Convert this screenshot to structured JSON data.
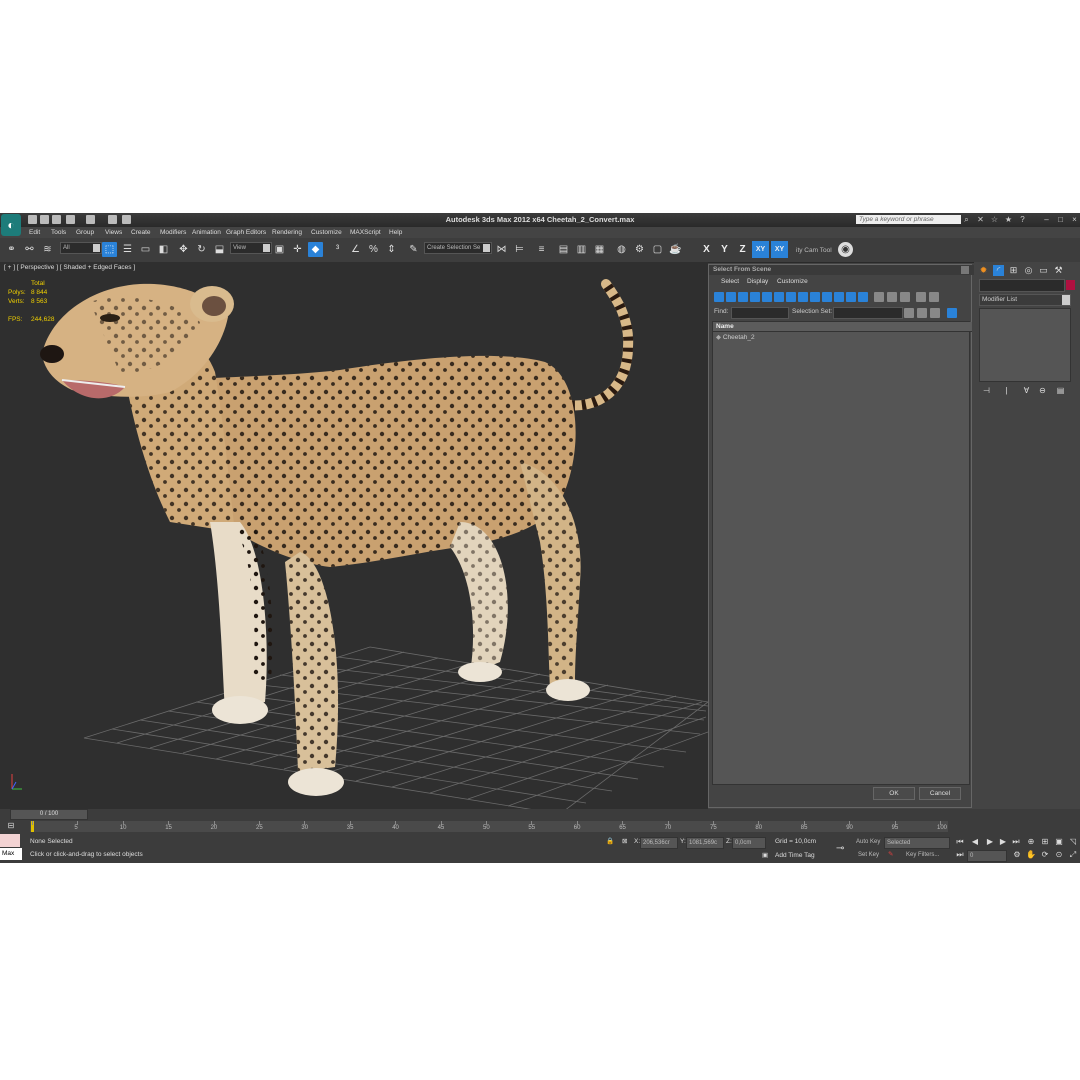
{
  "window": {
    "title": "Autodesk 3ds Max  2012 x64     Cheetah_2_Convert.max",
    "search_placeholder": "Type a keyword or phrase"
  },
  "menu": [
    "Edit",
    "Tools",
    "Group",
    "Views",
    "Create",
    "Modifiers",
    "Animation",
    "Graph Editors",
    "Rendering",
    "Customize",
    "MAXScript",
    "Help"
  ],
  "toolbar": {
    "filter_value": "All",
    "refcoord_value": "View",
    "named_selection": "Create Selection Se",
    "axis_buttons": [
      "X",
      "Y",
      "Z",
      "XY",
      "XY"
    ],
    "camtool_label": "ity Cam Tool"
  },
  "viewport": {
    "label": "[ + ] [ Perspective ] [ Shaded + Edged Faces ]",
    "stats": {
      "total_label": "Total",
      "polys_label": "Polys:",
      "polys_value": "8 844",
      "verts_label": "Verts:",
      "verts_value": "8 563",
      "fps_label": "FPS:",
      "fps_value": "244,628"
    }
  },
  "dialog": {
    "title": "Select From Scene",
    "menu": [
      "Select",
      "Display",
      "Customize"
    ],
    "find_label": "Find:",
    "selection_set_label": "Selection Set:",
    "list_header": "Name",
    "items": [
      "Cheetah_2"
    ],
    "ok_label": "OK",
    "cancel_label": "Cancel"
  },
  "command_panel": {
    "modifier_list": "Modifier List"
  },
  "timeline": {
    "slider_label": "0 / 100",
    "ticks": [
      "0",
      "5",
      "10",
      "15",
      "20",
      "25",
      "30",
      "35",
      "40",
      "45",
      "50",
      "55",
      "60",
      "65",
      "70",
      "75",
      "80",
      "85",
      "90",
      "95",
      "100"
    ]
  },
  "status": {
    "selection": "None Selected",
    "prompt": "Click or click-and-drag to select objects",
    "maxscript_label": "Max",
    "x_label": "X:",
    "x_value": "206,536cr",
    "y_label": "Y:",
    "y_value": "1081,569c",
    "z_label": "Z:",
    "z_value": "0,0cm",
    "grid": "Grid = 10,0cm",
    "add_time_tag": "Add Time Tag",
    "auto_key": "Auto Key",
    "auto_key_mode": "Selected",
    "set_key": "Set Key",
    "key_filters": "Key Filters...",
    "frame_value": "0"
  },
  "colors": {
    "active_blue": "#2a82d8",
    "stats_yellow": "#f0d000",
    "object_color": "#b01040"
  }
}
